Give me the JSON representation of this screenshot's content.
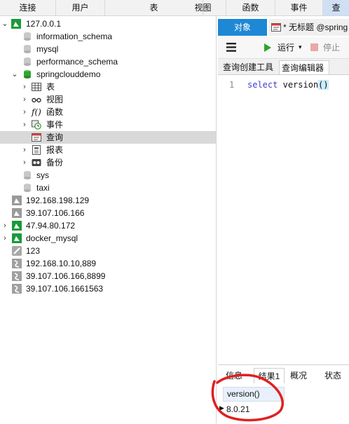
{
  "topbar": {
    "buttons": [
      {
        "label": "连接"
      },
      {
        "label": "用户"
      },
      {
        "label": "表"
      },
      {
        "label": "视图"
      },
      {
        "label": "函数"
      },
      {
        "label": "事件"
      },
      {
        "label": "查"
      }
    ]
  },
  "tree": {
    "nodes": [
      {
        "label": "127.0.0.1"
      },
      {
        "label": "information_schema"
      },
      {
        "label": "mysql"
      },
      {
        "label": "performance_schema"
      },
      {
        "label": "springclouddemo"
      },
      {
        "label": "表"
      },
      {
        "label": "视图"
      },
      {
        "label": "函数"
      },
      {
        "label": "事件"
      },
      {
        "label": "查询"
      },
      {
        "label": "报表"
      },
      {
        "label": "备份"
      },
      {
        "label": "sys"
      },
      {
        "label": "taxi"
      },
      {
        "label": "192.168.198.129"
      },
      {
        "label": "39.107.106.166"
      },
      {
        "label": "47.94.80.172"
      },
      {
        "label": "docker_mysql"
      },
      {
        "label": "123"
      },
      {
        "label": "192.168.10.10,889"
      },
      {
        "label": "39.107.106.166,8899"
      },
      {
        "label": "39.107.106.1661563"
      }
    ]
  },
  "tabs": {
    "objects": "对象",
    "document": "* 无标题 @spring"
  },
  "toolbar": {
    "run": "运行",
    "stop": "停止"
  },
  "subtabs": {
    "builder": "查询创建工具",
    "editor": "查询编辑器"
  },
  "editor": {
    "line_number": "1",
    "keyword": "select",
    "func": "version",
    "parens": "()"
  },
  "results": {
    "tabs": [
      "信息",
      "结果1",
      "概况",
      "状态"
    ],
    "column": "version()",
    "value": "8.0.21"
  },
  "colors": {
    "accent": "#1e88d4",
    "server_icon": "#1a9a38",
    "db_icon": "#bdbdbd",
    "db_open_icon": "#33a532",
    "keyword": "#4040d0",
    "annotation": "#e02020"
  }
}
